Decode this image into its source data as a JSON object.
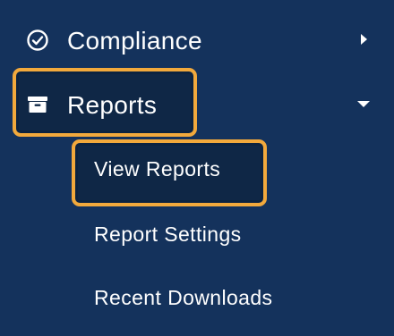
{
  "sidebar": {
    "items": [
      {
        "label": "Compliance",
        "icon": "check-circle-icon",
        "caret": "chevron-right-icon",
        "expanded": false
      },
      {
        "label": "Reports",
        "icon": "archive-box-icon",
        "caret": "caret-down-icon",
        "expanded": true,
        "highlighted": true,
        "children": [
          {
            "label": "View Reports",
            "highlighted": true
          },
          {
            "label": "Report Settings"
          },
          {
            "label": "Recent Downloads"
          }
        ]
      }
    ]
  },
  "colors": {
    "background": "#14325c",
    "highlight_border": "#f2a93c",
    "highlight_fill": "#0f2746",
    "text": "#ffffff"
  }
}
